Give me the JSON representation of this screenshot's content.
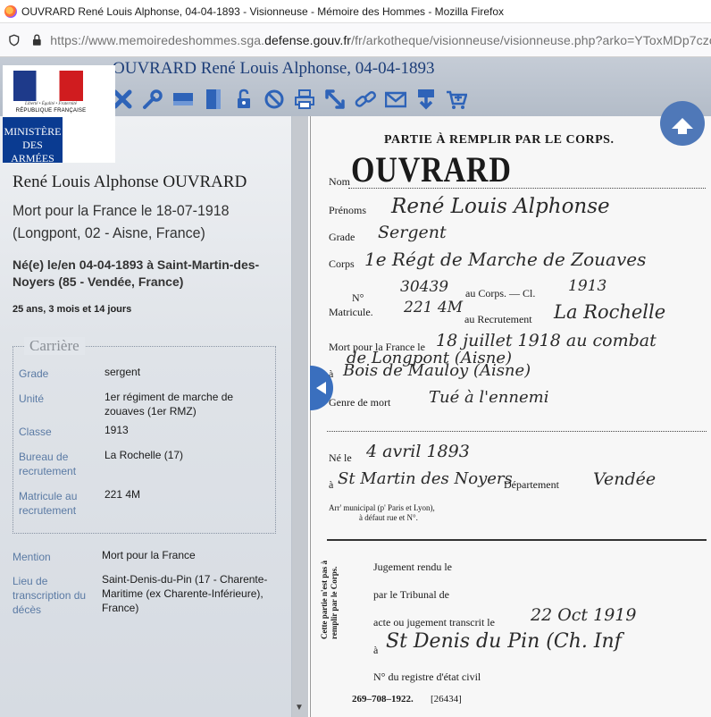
{
  "browser": {
    "window_title": "OUVRARD René Louis Alphonse, 04-04-1893 - Visionneuse - Mémoire des Hommes - Mozilla Firefox",
    "url_prefix": "https://www.memoiredeshommes.sga.",
    "url_domain": "defense.gouv.fr",
    "url_suffix": "/fr/arkotheque/visionneuse/visionneuse.php?arko=YToxMDp7czoxM"
  },
  "logo": {
    "motto": "Liberté • Égalité • Fraternité",
    "republic": "RÉPUBLIQUE FRANÇAISE",
    "ministry": "MINISTÈRE DES ARMÉES"
  },
  "header": {
    "title": "OUVRARD René Louis Alphonse, 04-04-1893",
    "toolbar_icons": [
      "close-icon",
      "settings-wrench-icon",
      "horizontal-layout-icon",
      "vertical-layout-icon",
      "unlock-icon",
      "forbidden-icon",
      "print-icon",
      "fullscreen-arrow-icon",
      "link-icon",
      "mail-icon",
      "download-icon",
      "cart-icon"
    ]
  },
  "person": {
    "name": "René Louis Alphonse OUVRARD",
    "death": "Mort pour la France le 18-07-1918 (Longpont, 02 - Aisne, France)",
    "birth": "Né(e) le/en 04-04-1893 à Saint-Martin-des-Noyers (85 - Vendée, France)",
    "age": "25 ans, 3 mois et 14 jours"
  },
  "career": {
    "legend": "Carrière",
    "grade_label": "Grade",
    "grade_value": "sergent",
    "unit_label": "Unité",
    "unit_value": "1er régiment de marche de zouaves (1er RMZ)",
    "class_label": "Classe",
    "class_value": "1913",
    "bureau_label": "Bureau de recrutement",
    "bureau_value": "La Rochelle (17)",
    "matricule_label": "Matricule au recrutement",
    "matricule_value": "221 4M"
  },
  "extra": {
    "mention_label": "Mention",
    "mention_value": "Mort pour la France",
    "transcription_label": "Lieu de transcription du décès",
    "transcription_value": "Saint-Denis-du-Pin (17 - Charente-Maritime (ex Charente-Inférieure), France)"
  },
  "document": {
    "heading": "PARTIE À REMPLIR PAR LE CORPS.",
    "nom_label": "Nom",
    "nom_value": "OUVRARD",
    "prenoms_label": "Prénoms",
    "prenoms_value": "René Louis Alphonse",
    "grade_label": "Grade",
    "grade_value": "Sergent",
    "corps_label": "Corps",
    "corps_value": "1e Régt de Marche de Zouaves",
    "matricule_no": "N°",
    "matricule_label": "Matricule.",
    "corps_no": "30439",
    "corps_no_label": "au Corps. — Cl.",
    "classe": "1913",
    "recrut_no": "221 4M",
    "recrut_label": "au Recrutement",
    "recrut_value": "La Rochelle",
    "mort_label": "Mort pour la France le",
    "mort_value": "18 juillet 1918 au combat",
    "mort_line2": "de Longpont (Aisne)",
    "a_label": "à",
    "a_value": "Bois de Mauloy (Aisne)",
    "genre_label": "Genre de mort",
    "genre_value": "Tué à l'ennemi",
    "ne_label": "Né le",
    "ne_value": "4 avril 1893",
    "ne_a_label": "à",
    "ne_a_value": "St Martin des Noyers",
    "dept_label": "Département",
    "dept_value": "Vendée",
    "arr_label": "Arr' municipal (p' Paris et Lyon),",
    "arr_label2": "à défaut rue et N°.",
    "side_note": "Cette partie n'est pas à remplir par le Corps.",
    "jugement_label": "Jugement rendu le",
    "tribunal_label": "par le Tribunal de",
    "acte_label": "acte ou jugement transcrit le",
    "acte_value": "22 Oct 1919",
    "transcrit_a": "à",
    "transcrit_value": "St Denis du Pin (Ch. Inf",
    "registre_label": "N° du registre d'état civil",
    "footer": "269–708–1922.",
    "footer_no": "[26434]"
  }
}
